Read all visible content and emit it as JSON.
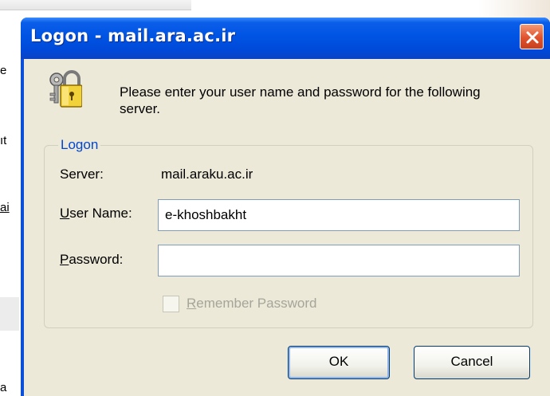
{
  "background": {
    "fragments": [
      "e",
      "ıt",
      "ai",
      "a"
    ]
  },
  "window": {
    "title": "Logon - mail.ara.ac.ir",
    "close_icon": "close-icon"
  },
  "dialog": {
    "icon": "keys-lock-icon",
    "prompt": "Please enter your user name and password for the following server.",
    "group_label": "Logon",
    "server_label": "Server:",
    "server_value": "mail.araku.ac.ir",
    "username_label_underline": "U",
    "username_label_rest": "ser Name:",
    "username_value": "e-khoshbakht",
    "password_label_underline": "P",
    "password_label_rest": "assword:",
    "password_value": "",
    "remember_underline": "R",
    "remember_rest": "emember Password",
    "remember_checked": false,
    "remember_enabled": false,
    "ok_label": "OK",
    "cancel_label": "Cancel"
  },
  "colors": {
    "titlebar": "#0054e3",
    "frame": "#0b4fd8",
    "client": "#ece9d8",
    "group_label": "#0046d5",
    "close_button": "#e0522c"
  }
}
